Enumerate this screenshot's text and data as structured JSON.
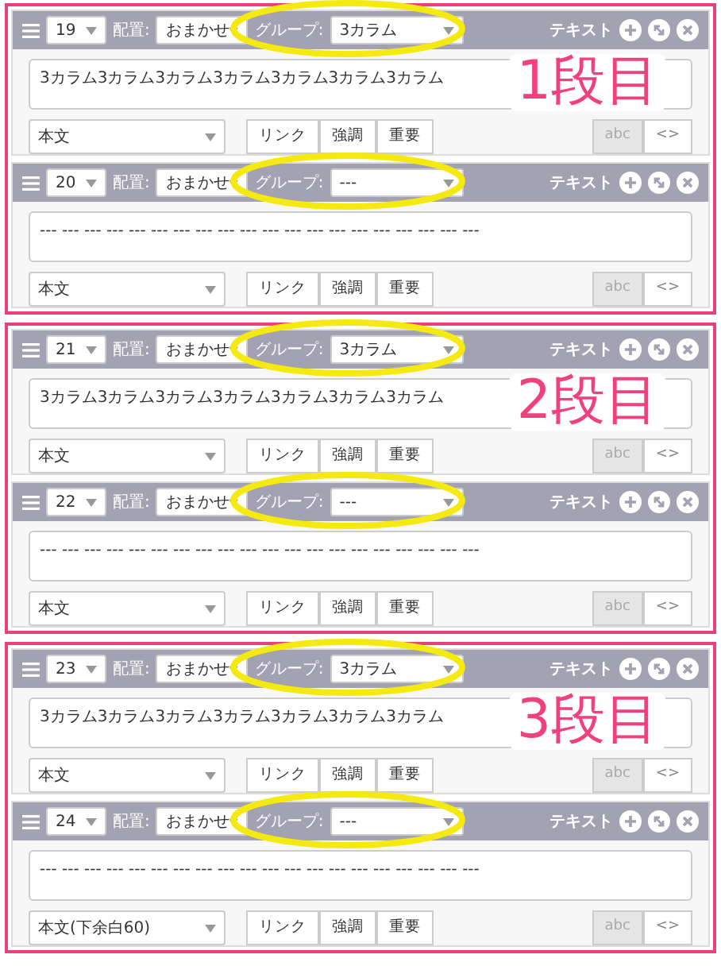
{
  "sections": [
    {
      "annotation": "1段目",
      "blocks": [
        {
          "number": "19",
          "layout_label": "配置:",
          "layout": "おまかせ",
          "group_label": "グループ:",
          "group": "3カラム",
          "type": "テキスト",
          "text": "3カラム3カラム3カラム3カラム3カラム3カラム3カラム",
          "style": "本文",
          "format_buttons": [
            "リンク",
            "強調",
            "重要"
          ],
          "mode_buttons": [
            {
              "label": "abc",
              "selected": true
            },
            {
              "label": "<>",
              "selected": false
            }
          ],
          "group_circled": true
        },
        {
          "number": "20",
          "layout_label": "配置:",
          "layout": "おまかせ",
          "group_label": "グループ:",
          "group": "---",
          "type": "テキスト",
          "text": "--- --- --- --- --- --- --- --- --- --- --- --- --- --- --- --- --- --- --- ---",
          "style": "本文",
          "format_buttons": [
            "リンク",
            "強調",
            "重要"
          ],
          "mode_buttons": [
            {
              "label": "abc",
              "selected": true
            },
            {
              "label": "<>",
              "selected": false
            }
          ],
          "group_circled": true
        }
      ]
    },
    {
      "annotation": "2段目",
      "blocks": [
        {
          "number": "21",
          "layout_label": "配置:",
          "layout": "おまかせ",
          "group_label": "グループ:",
          "group": "3カラム",
          "type": "テキスト",
          "text": "3カラム3カラム3カラム3カラム3カラム3カラム3カラム",
          "style": "本文",
          "format_buttons": [
            "リンク",
            "強調",
            "重要"
          ],
          "mode_buttons": [
            {
              "label": "abc",
              "selected": true
            },
            {
              "label": "<>",
              "selected": false
            }
          ],
          "group_circled": true
        },
        {
          "number": "22",
          "layout_label": "配置:",
          "layout": "おまかせ",
          "group_label": "グループ:",
          "group": "---",
          "type": "テキスト",
          "text": "--- --- --- --- --- --- --- --- --- --- --- --- --- --- --- --- --- --- --- ---",
          "style": "本文",
          "format_buttons": [
            "リンク",
            "強調",
            "重要"
          ],
          "mode_buttons": [
            {
              "label": "abc",
              "selected": true
            },
            {
              "label": "<>",
              "selected": false
            }
          ],
          "group_circled": true
        }
      ]
    },
    {
      "annotation": "3段目",
      "blocks": [
        {
          "number": "23",
          "layout_label": "配置:",
          "layout": "おまかせ",
          "group_label": "グループ:",
          "group": "3カラム",
          "type": "テキスト",
          "text": "3カラム3カラム3カラム3カラム3カラム3カラム3カラム",
          "style": "本文",
          "format_buttons": [
            "リンク",
            "強調",
            "重要"
          ],
          "mode_buttons": [
            {
              "label": "abc",
              "selected": true
            },
            {
              "label": "<>",
              "selected": false
            }
          ],
          "group_circled": true
        },
        {
          "number": "24",
          "layout_label": "配置:",
          "layout": "おまかせ",
          "group_label": "グループ:",
          "group": "---",
          "type": "テキスト",
          "text": "--- --- --- --- --- --- --- --- --- --- --- --- --- --- --- --- --- --- --- ---",
          "style": "本文(下余白60)",
          "format_buttons": [
            "リンク",
            "強調",
            "重要"
          ],
          "mode_buttons": [
            {
              "label": "abc",
              "selected": true
            },
            {
              "label": "<>",
              "selected": false
            }
          ],
          "group_circled": true
        }
      ]
    }
  ]
}
